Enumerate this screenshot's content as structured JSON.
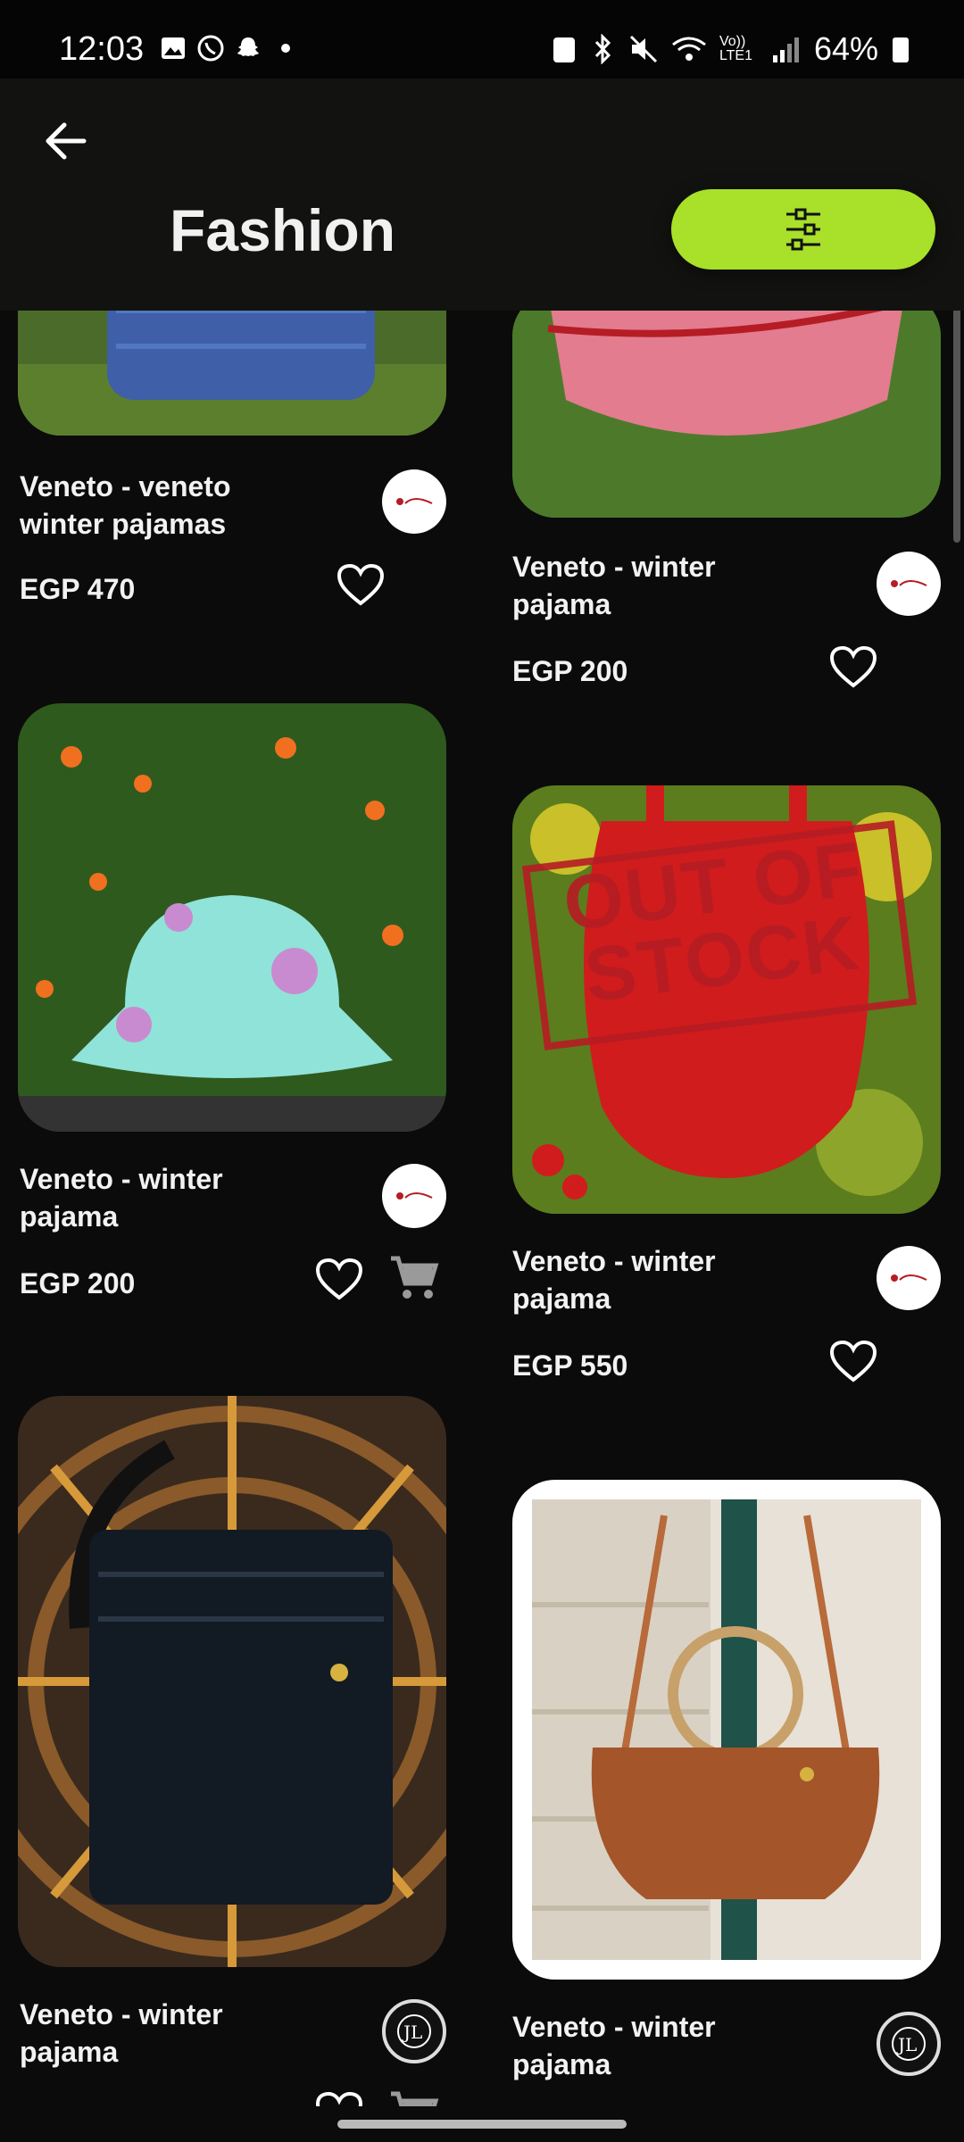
{
  "status": {
    "time": "12:03",
    "battery": "64%",
    "network": "Vo)) LTE1"
  },
  "header": {
    "title": "Fashion"
  },
  "products": [
    {
      "name": "Veneto  - veneto winter pajamas",
      "price": "EGP 470"
    },
    {
      "name": "Veneto  - winter pajama",
      "price": "EGP 200"
    },
    {
      "name": "Veneto  - winter pajama",
      "price": "EGP 200"
    },
    {
      "name": "Veneto  - winter pajama",
      "price": "EGP 550",
      "badge": "OUT OF STOCK"
    },
    {
      "name": "Veneto  - winter pajama",
      "price": ""
    },
    {
      "name": "Veneto  - winter pajama",
      "price": ""
    }
  ],
  "icons": {
    "back": "back-arrow-icon",
    "filter": "sliders-icon",
    "favorite": "heart-icon",
    "cart": "cart-icon"
  },
  "colors": {
    "accent": "#a8e02a",
    "background": "#0b0b0b",
    "header": "#121310"
  }
}
